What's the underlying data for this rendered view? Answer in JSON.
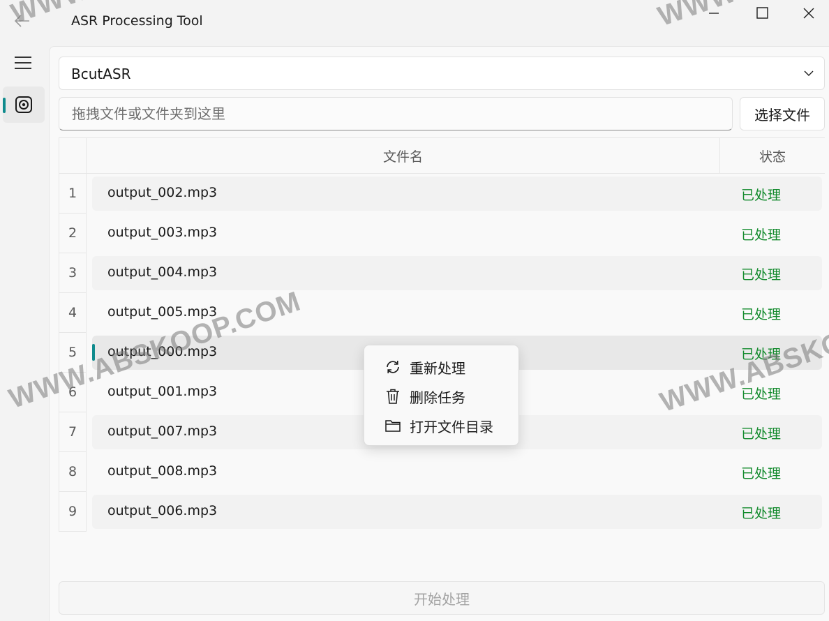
{
  "window": {
    "title": "ASR Processing Tool"
  },
  "asr_engine": {
    "selected": "BcutASR"
  },
  "file_input": {
    "placeholder": "拖拽文件或文件夹到这里",
    "choose_button": "选择文件"
  },
  "table": {
    "columns": [
      "文件名",
      "状态"
    ],
    "rows": [
      {
        "index": "1",
        "file": "output_002.mp3",
        "status": "已处理"
      },
      {
        "index": "2",
        "file": "output_003.mp3",
        "status": "已处理"
      },
      {
        "index": "3",
        "file": "output_004.mp3",
        "status": "已处理"
      },
      {
        "index": "4",
        "file": "output_005.mp3",
        "status": "已处理"
      },
      {
        "index": "5",
        "file": "output_000.mp3",
        "status": "已处理",
        "selected": true
      },
      {
        "index": "6",
        "file": "output_001.mp3",
        "status": "已处理"
      },
      {
        "index": "7",
        "file": "output_007.mp3",
        "status": "已处理"
      },
      {
        "index": "8",
        "file": "output_008.mp3",
        "status": "已处理"
      },
      {
        "index": "9",
        "file": "output_006.mp3",
        "status": "已处理"
      }
    ]
  },
  "context_menu": {
    "items": [
      {
        "label": "重新处理",
        "icon": "refresh-icon"
      },
      {
        "label": "删除任务",
        "icon": "trash-icon"
      },
      {
        "label": "打开文件目录",
        "icon": "folder-icon"
      }
    ]
  },
  "start_button": "开始处理",
  "watermarks": [
    "WWW.ABSKOOP.COM",
    "WWW.ABSKOOP.COM",
    "WWW.ABSKOOP.COM",
    "WWW.ABSKOOP.COM"
  ],
  "colors": {
    "accent": "#0f8b8d",
    "status_done": "#128a2c"
  }
}
